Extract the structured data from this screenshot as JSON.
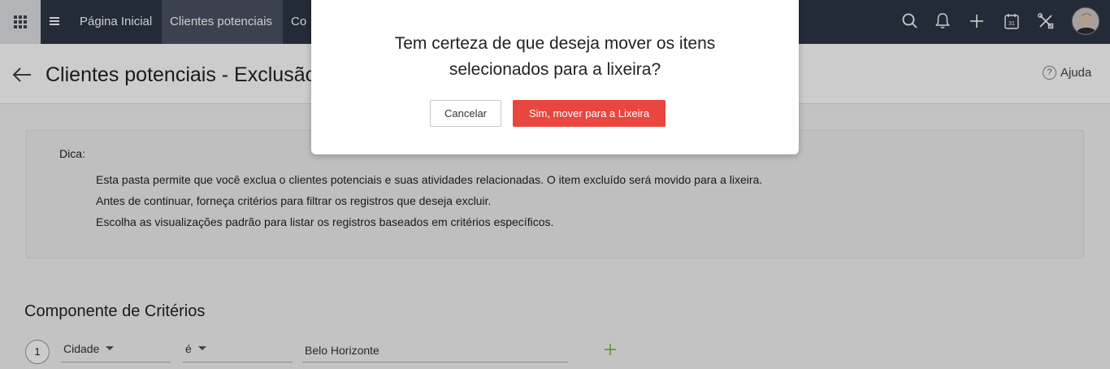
{
  "nav": {
    "tabs": [
      "Página Inicial",
      "Clientes potenciais",
      "Co"
    ],
    "icons": [
      "apps-grid-icon",
      "menu-icon",
      "search-icon",
      "bell-icon",
      "plus-icon",
      "calendar-icon",
      "tools-icon",
      "avatar"
    ],
    "calendar_day": "31"
  },
  "header": {
    "title": "Clientes potenciais - Exclusão",
    "help_label": "Ajuda",
    "help_icon_glyph": "?"
  },
  "tip": {
    "label": "Dica:",
    "lines": [
      "Esta pasta permite que você exclua o clientes potenciais e suas atividades relacionadas. O item excluído será movido para a lixeira.",
      "Antes de continuar, forneça critérios para filtrar os registros que deseja excluir.",
      "Escolha as visualizações padrão para listar os registros baseados em critérios específicos."
    ]
  },
  "criteria": {
    "title": "Componente de Critérios",
    "rows": [
      {
        "number": "1",
        "field": "Cidade",
        "operator": "é",
        "value": "Belo Horizonte"
      }
    ]
  },
  "modal": {
    "message": "Tem certeza de que deseja mover os itens selecionados para a lixeira?",
    "cancel_label": "Cancelar",
    "confirm_label": "Sim, mover para a Lixeira"
  },
  "colors": {
    "topbar": "#2e3646",
    "active_tab": "#4a5263",
    "confirm": "#e9463f",
    "add_criteria": "#7cb342"
  }
}
